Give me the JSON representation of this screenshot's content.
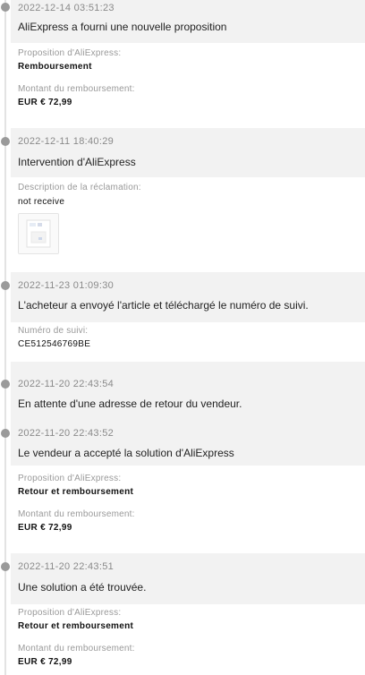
{
  "events": [
    {
      "time": "2022-12-14 03:51:23",
      "title": "AliExpress a fourni une nouvelle proposition",
      "details": [
        {
          "label": "Proposition d'AliExpress:",
          "value": "Remboursement"
        },
        {
          "label": "Montant du remboursement:",
          "value": "EUR € 72,99"
        }
      ]
    },
    {
      "time": "2022-12-11 18:40:29",
      "title": "Intervention d'AliExpress",
      "details": [
        {
          "label": "Description de la réclamation:",
          "value": "not receive"
        }
      ],
      "attachment_icon": "image-attachment-thumbnail"
    },
    {
      "time": "2022-11-23 01:09:30",
      "title": "L'acheteur a envoyé l'article et téléchargé le numéro de suivi.",
      "details": [
        {
          "label": "Numéro de suivi:",
          "value": "CE512546769BE"
        }
      ]
    },
    {
      "time": "2022-11-20 22:43:54",
      "title": "En attente d'une adresse de retour du vendeur."
    },
    {
      "time": "2022-11-20 22:43:52",
      "title": "Le vendeur a accepté la solution d'AliExpress",
      "details": [
        {
          "label": "Proposition d'AliExpress:",
          "value": "Retour et remboursement"
        },
        {
          "label": "Montant du remboursement:",
          "value": "EUR € 72,99"
        }
      ]
    },
    {
      "time": "2022-11-20 22:43:51",
      "title": "Une solution a été trouvée.",
      "details": [
        {
          "label": "Proposition d'AliExpress:",
          "value": "Retour et remboursement"
        },
        {
          "label": "Montant du remboursement:",
          "value": "EUR € 72,99"
        }
      ]
    }
  ],
  "colors": {
    "timeline_dot": "#9a9a9a",
    "timeline_line": "#e3e3e3",
    "header_band": "#f2f2f2"
  }
}
